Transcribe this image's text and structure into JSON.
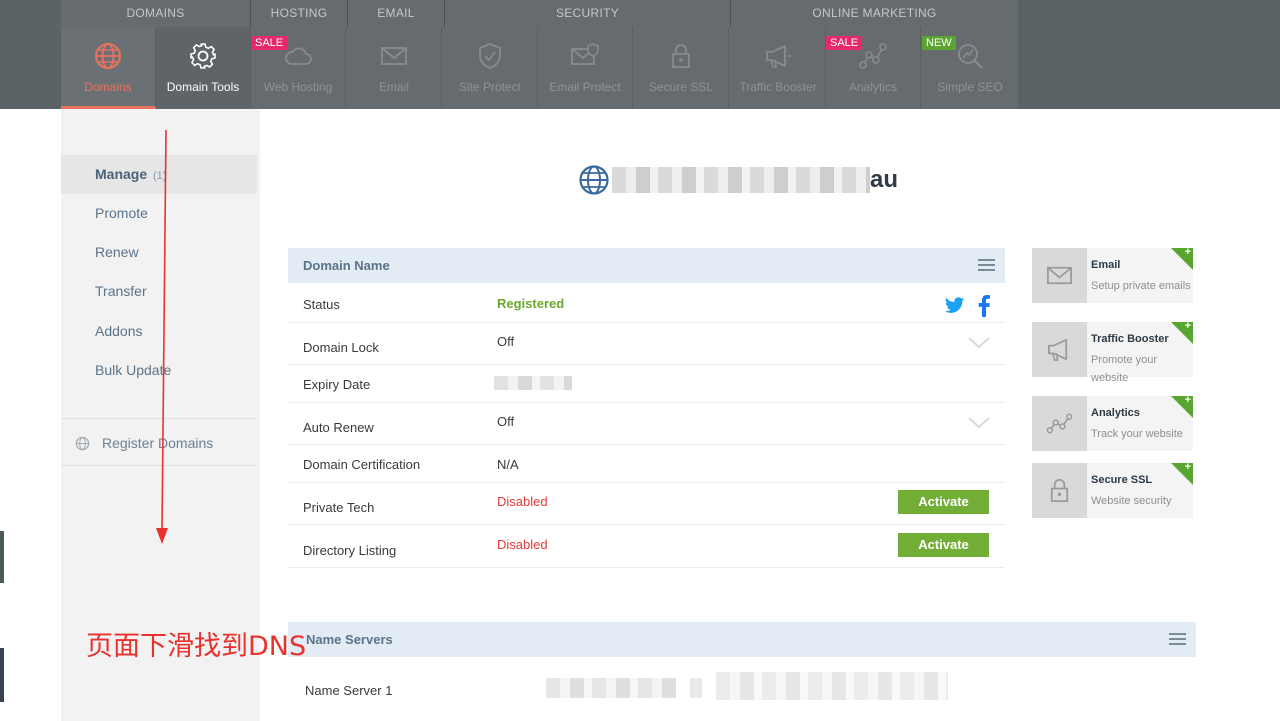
{
  "nav": {
    "groups": [
      {
        "label": "DOMAINS"
      },
      {
        "label": "HOSTING"
      },
      {
        "label": "EMAIL"
      },
      {
        "label": "SECURITY"
      },
      {
        "label": "ONLINE MARKETING"
      }
    ],
    "tiles": [
      {
        "label": "Domains",
        "icon": "globe-icon",
        "state": "active"
      },
      {
        "label": "Domain Tools",
        "icon": "gear-icon",
        "state": "selected"
      },
      {
        "label": "Web Hosting",
        "icon": "cloud-icon",
        "badge": "SALE"
      },
      {
        "label": "Email",
        "icon": "envelope-icon"
      },
      {
        "label": "Site Protect",
        "icon": "shield-icon"
      },
      {
        "label": "Email Protect",
        "icon": "email-shield-icon"
      },
      {
        "label": "Secure SSL",
        "icon": "lock-icon"
      },
      {
        "label": "Traffic Booster",
        "icon": "megaphone-icon"
      },
      {
        "label": "Analytics",
        "icon": "analytics-icon",
        "badge": "SALE"
      },
      {
        "label": "Simple SEO",
        "icon": "seo-icon",
        "badge": "NEW"
      }
    ],
    "accent": "#e8735f"
  },
  "sidebar": {
    "items": [
      {
        "label": "Manage",
        "count": "(1)"
      },
      {
        "label": "Promote"
      },
      {
        "label": "Renew"
      },
      {
        "label": "Transfer"
      },
      {
        "label": "Addons"
      },
      {
        "label": "Bulk Update"
      }
    ],
    "register_label": "Register Domains"
  },
  "domain": {
    "suffix": "au"
  },
  "details": {
    "header": "Domain Name",
    "rows": [
      {
        "label": "Status",
        "value": "Registered"
      },
      {
        "label": "Domain Lock",
        "value": "Off"
      },
      {
        "label": "Expiry Date",
        "value": ""
      },
      {
        "label": "Auto Renew",
        "value": "Off"
      },
      {
        "label": "Domain Certification",
        "value": "N/A"
      },
      {
        "label": "Private Tech",
        "value": "Disabled",
        "action": "Activate"
      },
      {
        "label": "Directory Listing",
        "value": "Disabled",
        "action": "Activate"
      }
    ]
  },
  "nameservers": {
    "header": "Name Servers",
    "rows": [
      {
        "label": "Name Server 1"
      }
    ]
  },
  "cards": [
    {
      "title": "Email",
      "desc": "Setup private emails",
      "icon": "envelope-icon"
    },
    {
      "title": "Traffic Booster",
      "desc": "Promote your website",
      "icon": "megaphone-icon"
    },
    {
      "title": "Analytics",
      "desc": "Track your website",
      "icon": "analytics-icon"
    },
    {
      "title": "Secure SSL",
      "desc": "Website security",
      "icon": "lock-icon"
    }
  ],
  "card_badge": "+",
  "annotation": "页面下滑找到DNS",
  "colors": {
    "green": "#72ae36",
    "red": "#e03a3a",
    "header_bg": "#e3ebf5"
  }
}
